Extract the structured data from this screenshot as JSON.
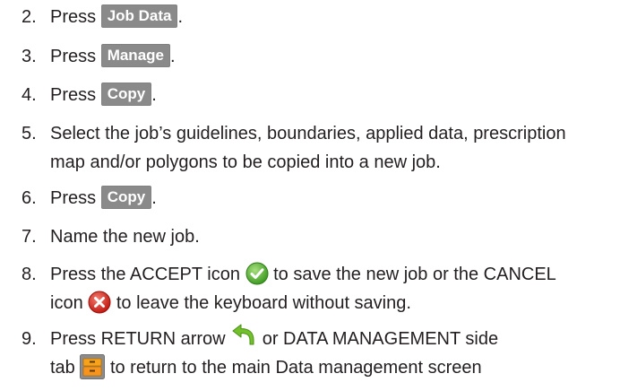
{
  "steps": [
    {
      "num": "2.",
      "pre": "Press",
      "button": "Job Data",
      "post": "."
    },
    {
      "num": "3.",
      "pre": "Press",
      "button": "Manage",
      "post": "."
    },
    {
      "num": "4.",
      "pre": "Press",
      "button": "Copy",
      "post": "."
    },
    {
      "num": "5.",
      "line1": "Select the job’s guidelines, boundaries, applied data, prescription",
      "line2": "map and/or polygons to be copied into a new job."
    },
    {
      "num": "6.",
      "pre": "Press",
      "button": "Copy",
      "post": "."
    },
    {
      "num": "7.",
      "text": "Name the new job."
    },
    {
      "num": "8.",
      "a": "Press the ACCEPT icon",
      "b": "to save the new job or the CANCEL",
      "c": "icon",
      "d": "to leave the keyboard without saving.",
      "accept_icon": "accept-check-icon",
      "cancel_icon": "cancel-x-icon"
    },
    {
      "num": "9.",
      "a": "Press RETURN arrow",
      "b": "or DATA MANAGEMENT side",
      "c": "tab",
      "d": "to return to the main Data management screen",
      "return_icon": "return-arrow-icon",
      "tab_icon": "data-management-tab-icon"
    }
  ],
  "colors": {
    "text": "#231f20",
    "button_bg": "#8a8a8a",
    "button_text": "#ffffff",
    "accept_green": "#4fae2f",
    "cancel_red": "#d9261c",
    "return_green": "#6fbf2a",
    "tab_orange": "#f7941d"
  }
}
